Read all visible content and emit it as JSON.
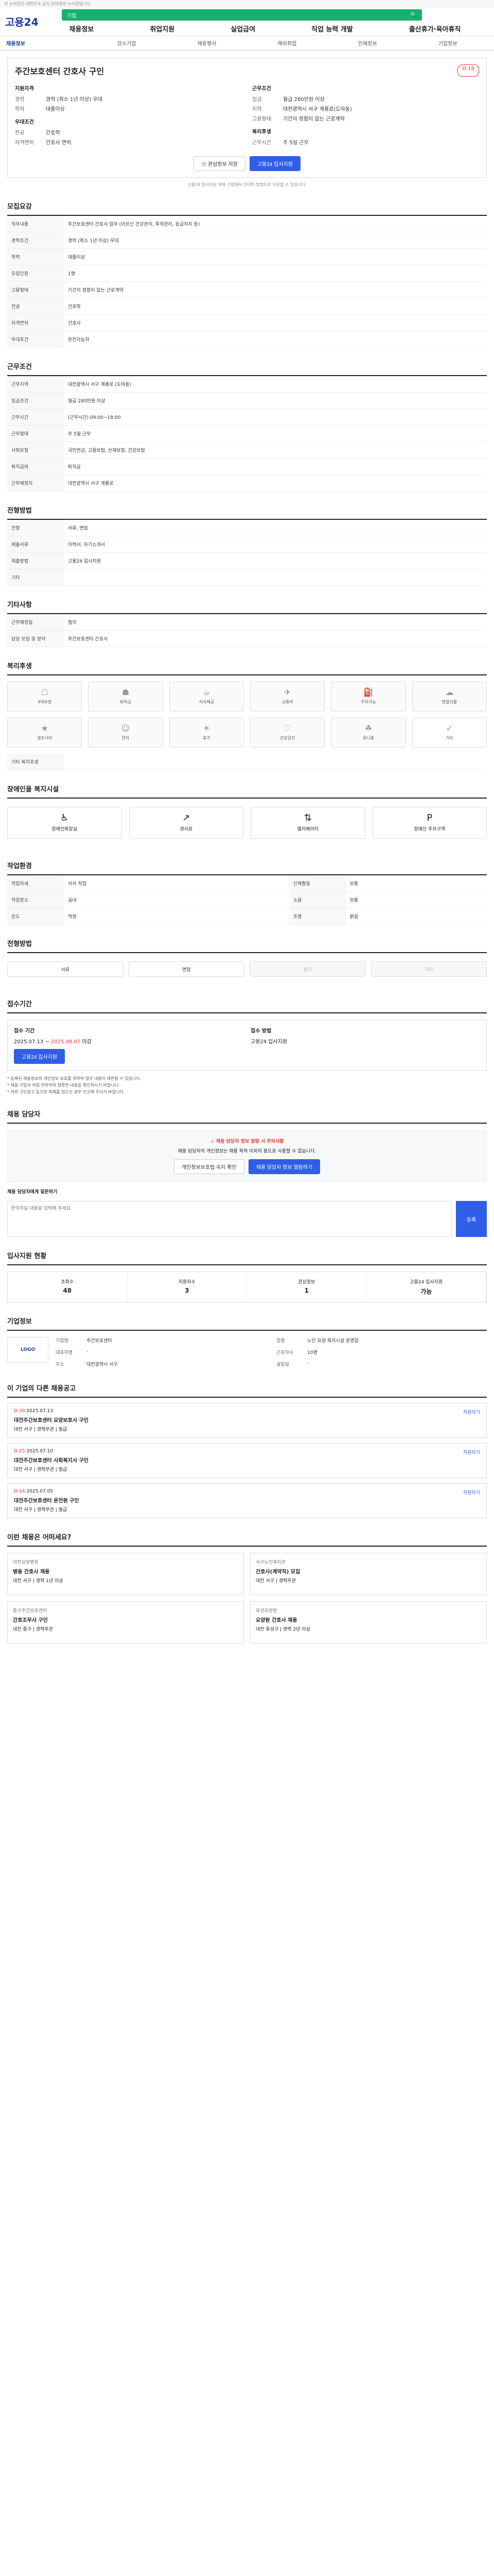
{
  "topbar": {
    "text": "이 누리집은 대한민국 공식 전자정부 누리집입니다."
  },
  "header": {
    "logo": "고용24",
    "search_placeholder": "기업",
    "nav": [
      "채용정보",
      "취업지원",
      "실업급여",
      "직업 능력 개발",
      "출산휴가·육아휴직"
    ]
  },
  "subtabs": [
    "채용정보",
    "강소기업",
    "채용행사",
    "해외취업",
    "인재정보",
    "기업정보"
  ],
  "job": {
    "title": "주간보호센터 간호사 구인",
    "dday": "D-19",
    "summary_left_title": "지원자격",
    "summary_left": [
      {
        "k": "경력",
        "v": "경력 (최소 1년 이상) 우대"
      },
      {
        "k": "학력",
        "v": "대졸이상"
      }
    ],
    "summary_left2_title": "우대조건",
    "summary_left2": [
      {
        "k": "전공",
        "v": "간호학"
      },
      {
        "k": "자격면허",
        "v": "간호사 면허"
      }
    ],
    "summary_right_title": "근무조건",
    "summary_right": [
      {
        "k": "임금",
        "v": "월급 280만원 이상"
      },
      {
        "k": "지역",
        "v": "대전광역시 서구 계룡로(도마동)"
      },
      {
        "k": "고용형태",
        "v": "기간의 정함이 없는 근로계약"
      }
    ],
    "summary_right2_title": "복리후생",
    "summary_right2": [
      {
        "k": "근무시간",
        "v": "주 5일 근무"
      }
    ],
    "btn_scrap": "관심정보 저장",
    "btn_apply": "고용24 입사지원",
    "notice": "고용24 입사지원 외에 기업에서 안내한 방법으로 지원할 수 있습니다."
  },
  "sections": {
    "recruit_title": "모집요강",
    "recruit_rows": [
      {
        "k": "직무내용",
        "v": "주간보호센터 간호사 업무 (어르신 건강관리, 투약관리, 응급처치 등)"
      },
      {
        "k": "경력조건",
        "v": "경력 (최소 1년 이상) 우대"
      },
      {
        "k": "학력",
        "v": "대졸이상"
      },
      {
        "k": "모집인원",
        "v": "1명"
      },
      {
        "k": "고용형태",
        "v": "기간의 정함이 없는 근로계약"
      },
      {
        "k": "전공",
        "v": "간호학"
      },
      {
        "k": "자격면허",
        "v": "간호사"
      },
      {
        "k": "우대조건",
        "v": "운전가능자"
      }
    ],
    "work_title": "근무조건",
    "work_rows": [
      {
        "k": "근무지역",
        "v": "대전광역시 서구 계룡로 (도마동)"
      },
      {
        "k": "임금조건",
        "v": "월급 280만원 이상"
      },
      {
        "k": "근무시간",
        "v": "(근무시간) 09:00~18:00"
      },
      {
        "k": "근무형태",
        "v": "주 5일 근무"
      },
      {
        "k": "사회보험",
        "v": "국민연금, 고용보험, 산재보험, 건강보험"
      },
      {
        "k": "퇴직급여",
        "v": "퇴직금"
      },
      {
        "k": "근무예정지",
        "v": "대전광역시 서구 계룡로"
      }
    ],
    "process_title": "전형방법",
    "process_rows": [
      {
        "k": "전형",
        "v": "서류, 면접"
      },
      {
        "k": "제출서류",
        "v": "이력서, 자기소개서"
      },
      {
        "k": "제출방법",
        "v": "고용24 입사지원"
      },
      {
        "k": "기타",
        "v": ""
      }
    ],
    "etc_title": "기타사항",
    "etc_rows": [
      {
        "k": "근무예정일",
        "v": "협의"
      },
      {
        "k": "담당 모집 및 분야",
        "v": "주간보호센터 간호사"
      }
    ],
    "benefit_title": "복리후생",
    "benefits": [
      "4대보험",
      "퇴직금",
      "식사제공",
      "교통비",
      "주차가능",
      "명절선물",
      "경조사비",
      "연차",
      "휴가",
      "건강검진",
      "유니폼",
      "기타"
    ],
    "benefit_extra": "기타 복리후생",
    "disabled_title": "장애인을 복지시설",
    "disabled": [
      "장애인화장실",
      "경사로",
      "엘리베이터",
      "장애인 주차구역"
    ],
    "env_title": "작업환경",
    "env_rows": [
      {
        "k": "작업자세",
        "v": "서서 작업",
        "k2": "신체활동",
        "v2": "보통"
      },
      {
        "k": "작업장소",
        "v": "실내",
        "k2": "소음",
        "v2": "보통"
      },
      {
        "k": "온도",
        "v": "적정",
        "k2": "조명",
        "v2": "밝음"
      }
    ],
    "method_title": "전형방법",
    "methods": [
      "서류",
      "면접",
      "필기",
      "기타"
    ],
    "period_title": "접수기간",
    "period_start_label": "접수 기간",
    "period_start": "2025.07.13",
    "period_end": "2025.08.07",
    "period_end_label": "마감",
    "period_method_label": "접수 방법",
    "period_method": "고용24 입사지원",
    "notes": [
      "* 등록된 채용정보의 개인정보 보호를 위하여 일부 내용이 제한될 수 있습니다.",
      "* 채용 기업과 직접 연락하여 정확한 내용을 확인하시기 바랍니다.",
      "* 허위 구인광고 등으로 피해를 입으신 경우 신고해 주시기 바랍니다."
    ],
    "contact_title": "채용 담당자",
    "contact_warn": "채용 담당자 정보 열람 시 주의사항",
    "contact_desc": "채용 담당자의 개인정보는 채용 목적 이외의 용도로 사용할 수 없습니다.",
    "contact_btn1": "개인정보보호법 숙지 확인",
    "contact_btn2": "채용 담당자 정보 열람하기",
    "inquiry_label": "채용 담당자에게 질문하기",
    "inquiry_placeholder": "문의하실 내용을 입력해 주세요.",
    "inquiry_btn": "등록",
    "status_title": "입사지원 현황",
    "status": [
      {
        "k": "조회수",
        "v": "48"
      },
      {
        "k": "지원자수",
        "v": "3"
      },
      {
        "k": "관심정보",
        "v": "1"
      },
      {
        "k": "고용24 입사지원",
        "v": "가능"
      }
    ],
    "company_title": "기업정보",
    "company_logo": "LOGO",
    "company_rows": [
      {
        "k": "기업명",
        "v": "주간보호센터"
      },
      {
        "k": "업종",
        "v": "노인 요양 복지시설 운영업"
      },
      {
        "k": "대표자명",
        "v": "-"
      },
      {
        "k": "근로자수",
        "v": "10명"
      },
      {
        "k": "주소",
        "v": "대전광역시 서구"
      },
      {
        "k": "설립일",
        "v": "-"
      }
    ],
    "other_title": "이 기업의 다른 채용공고",
    "other_jobs": [
      {
        "d": "D-30",
        "date": "2025.07.13",
        "t": "대전주간보호센터 요양보호사 구인",
        "m": "대전 서구 | 경력무관 | 월급"
      },
      {
        "d": "D-25",
        "date": "2025.07.10",
        "t": "대전주간보호센터 사회복지사 구인",
        "m": "대전 서구 | 경력무관 | 월급"
      },
      {
        "d": "D-14",
        "date": "2025.07.05",
        "t": "대전주간보호센터 운전원 구인",
        "m": "대전 서구 | 경력무관 | 월급"
      }
    ],
    "other_action": "지원하기",
    "rec_title": "이런 채용은 어떠세요?",
    "rec": [
      {
        "co": "대전요양병원",
        "t": "병동 간호사 채용",
        "m": "대전 서구 | 경력 1년 이상"
      },
      {
        "co": "서구노인복지관",
        "t": "간호사(계약직) 모집",
        "m": "대전 서구 | 경력무관"
      },
      {
        "co": "중구주간보호센터",
        "t": "간호조무사 구인",
        "m": "대전 중구 | 경력무관"
      },
      {
        "co": "유성요양원",
        "t": "요양원 간호사 채용",
        "m": "대전 유성구 | 경력 2년 이상"
      }
    ]
  }
}
